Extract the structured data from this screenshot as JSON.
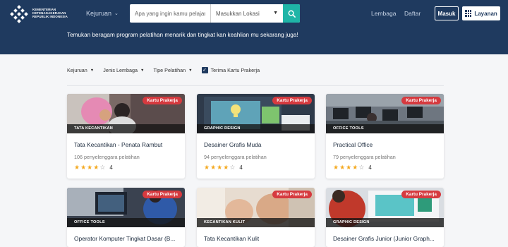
{
  "header": {
    "logo_lines": [
      "KEMENTERIAN",
      "KETENAGAKERJAAN",
      "REPUBLIK INDONESIA"
    ],
    "nav_kejuruan": "Kejuruan",
    "search": {
      "placeholder": "Apa yang ingin kamu pelajari?",
      "location_label": "Masukkan Lokasi"
    },
    "lembaga": "Lembaga",
    "daftar": "Daftar",
    "masuk": "Masuk",
    "layanan": "Layanan",
    "tagline": "Temukan beragam program pelatihan menarik dan tingkat kan keahlian mu sekarang juga!"
  },
  "filters": {
    "kejuruan": "Kejuruan",
    "jenis_lembaga": "Jenis Lembaga",
    "tipe_pelatihan": "Tipe Pelatihan",
    "prakerja_label": "Terima Kartu Prakerja",
    "prakerja_checked": true
  },
  "colors": {
    "header": "#1f3a5f",
    "accent": "#1fb5a7",
    "badge": "#d63a3f",
    "star": "#f4a81d"
  },
  "cards": [
    {
      "badge": "Kartu Prakerja",
      "category": "TATA KECANTIKAN",
      "title": "Tata Kecantikan - Penata Rambut",
      "count": "106 penyelenggara pelatihan",
      "rating": "4",
      "stars": 4
    },
    {
      "badge": "Kartu Prakerja",
      "category": "GRAPHIC DESIGN",
      "title": "Desainer Grafis Muda",
      "count": "94 penyelenggara pelatihan",
      "rating": "4",
      "stars": 4
    },
    {
      "badge": "Kartu Prakerja",
      "category": "OFFICE TOOLS",
      "title": "Practical Office",
      "count": "79 penyelenggara pelatihan",
      "rating": "4",
      "stars": 4
    },
    {
      "badge": "Kartu Prakerja",
      "category": "OFFICE TOOLS",
      "title": "Operator Komputer Tingkat Dasar (B...",
      "count": "",
      "rating": "",
      "stars": 0
    },
    {
      "badge": "Kartu Prakerja",
      "category": "KECANTIKAN KULIT",
      "title": "Tata Kecantikan Kulit",
      "count": "",
      "rating": "",
      "stars": 0
    },
    {
      "badge": "Kartu Prakerja",
      "category": "GRAPHIC DESIGN",
      "title": "Desainer Grafis Junior (Junior Graph...",
      "count": "",
      "rating": "",
      "stars": 0
    }
  ]
}
